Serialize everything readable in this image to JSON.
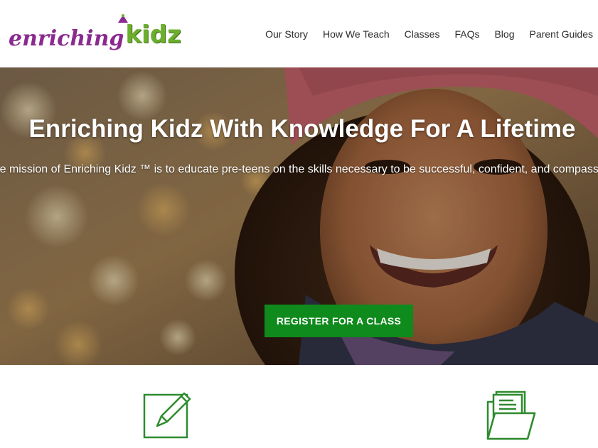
{
  "brand": {
    "logo_part1": "enriching",
    "logo_part2": "kidz",
    "logo_colors": {
      "purple": "#8a2a8f",
      "green": "#6cae2e"
    }
  },
  "nav": {
    "items": [
      {
        "label": "Our Story"
      },
      {
        "label": "How We Teach"
      },
      {
        "label": "Classes"
      },
      {
        "label": "FAQs"
      },
      {
        "label": "Blog"
      },
      {
        "label": "Parent Guides"
      }
    ]
  },
  "hero": {
    "title": "Enriching Kidz With Knowledge For A Lifetime",
    "subtitle": "The mission of Enriching Kidz ™ is to educate pre-teens on the skills necessary to be successful, confident, and compassionate individuals.",
    "cta_label": "REGISTER FOR A CLASS",
    "image": "smiling-girl-pink-knit-hat-autumn-photo"
  },
  "features": {
    "icons": [
      "edit-note-icon",
      "file-folder-icon"
    ]
  },
  "colors": {
    "accent_green": "#0f8a1c",
    "icon_green": "#2e8b2e",
    "nav_text": "#2b2b2b"
  }
}
